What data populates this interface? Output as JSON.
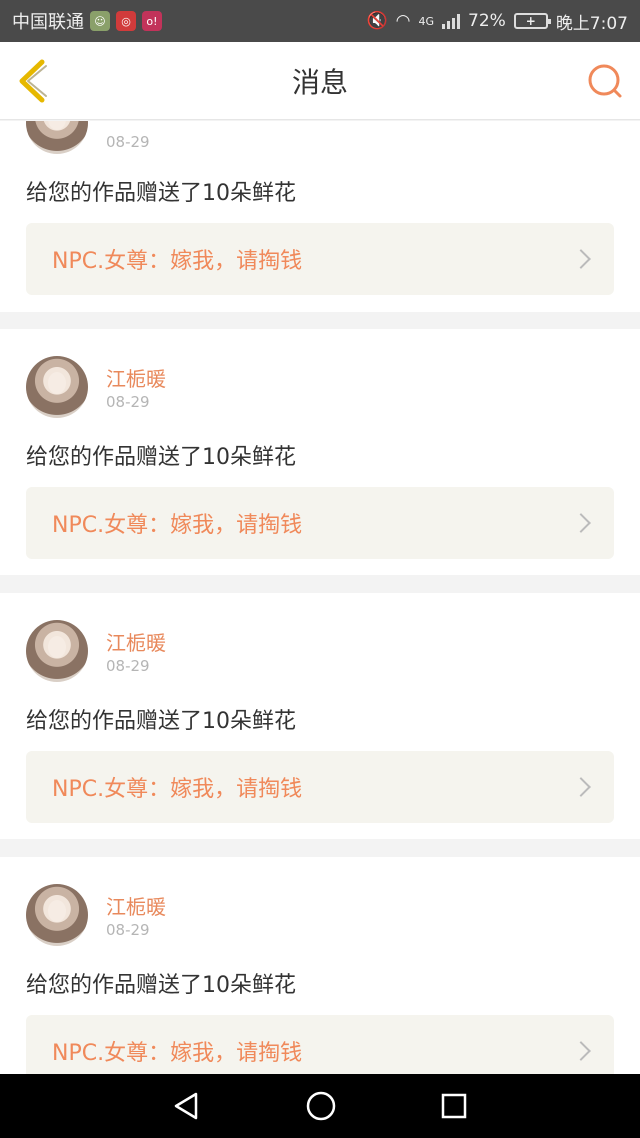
{
  "status_bar": {
    "carrier": "中国联通",
    "network": "4G",
    "battery": "72%",
    "time": "晚上7:07"
  },
  "header": {
    "title": "消息"
  },
  "messages": [
    {
      "sender": "",
      "date": "08-29",
      "text": "给您的作品赠送了10朵鲜花",
      "quote": "NPC.女尊：嫁我，请掏钱"
    },
    {
      "sender": "江栀暖",
      "date": "08-29",
      "text": "给您的作品赠送了10朵鲜花",
      "quote": "NPC.女尊：嫁我，请掏钱"
    },
    {
      "sender": "江栀暖",
      "date": "08-29",
      "text": "给您的作品赠送了10朵鲜花",
      "quote": "NPC.女尊：嫁我，请掏钱"
    },
    {
      "sender": "江栀暖",
      "date": "08-29",
      "text": "给您的作品赠送了10朵鲜花",
      "quote": "NPC.女尊：嫁我，请掏钱"
    }
  ],
  "colors": {
    "accent": "#f0895a",
    "sender": "#e8895c",
    "quote_bg": "#f5f4ee"
  }
}
